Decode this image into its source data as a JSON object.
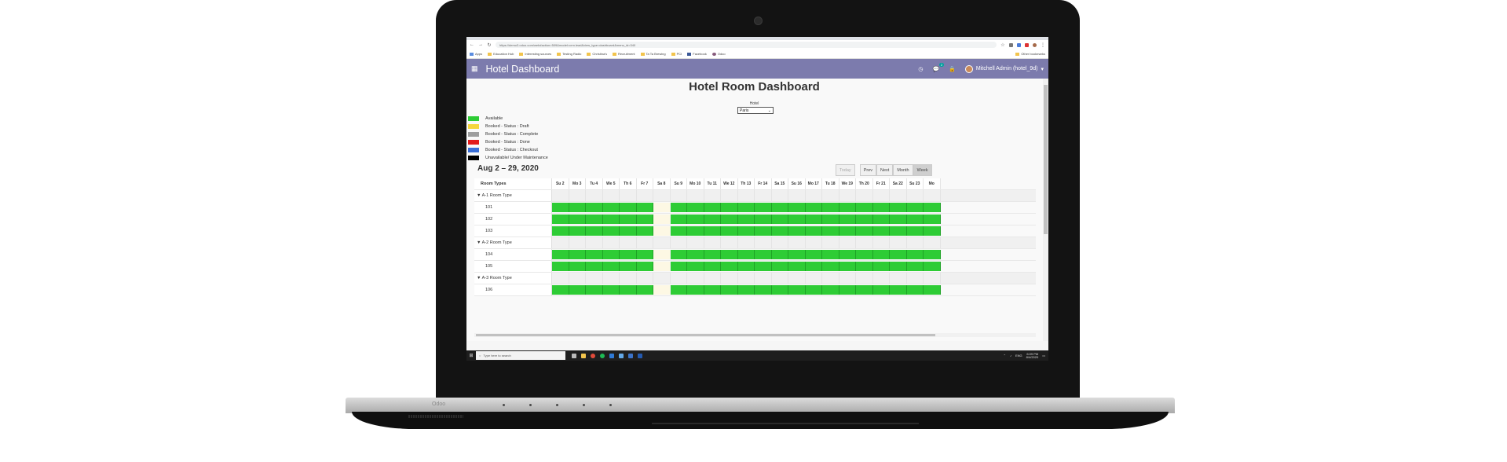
{
  "browser": {
    "url": "https://demo3.odoo.com/web#action=509&model=crm.lead&view_type=dashboard&menu_id=340",
    "bookmarks": [
      "Apps",
      "Education Hub",
      "Interesting sources",
      "Testing Radio",
      "Christina's",
      "Recruitment",
      "Ta Ta Brewing",
      "PCI",
      "Facebook",
      "Odoo"
    ],
    "other_bookmarks": "Other bookmarks"
  },
  "navbar": {
    "app_title": "Hotel Dashboard",
    "chat_count": "2",
    "user": "Mitchell Admin (hotel_9d)"
  },
  "page": {
    "title": "Hotel Room Dashboard",
    "hotel_label": "Hotel",
    "hotel_selected": "Paris"
  },
  "legend": [
    {
      "label": "Available",
      "color": "#2ecc35"
    },
    {
      "label": "Booked - Status : Draft",
      "color": "#f5d63d"
    },
    {
      "label": "Booked - Status : Complete",
      "color": "#9e9e9e"
    },
    {
      "label": "Booked - Status : Done",
      "color": "#e21b1b"
    },
    {
      "label": "Booked - Status : Checkout",
      "color": "#3a6fd8"
    },
    {
      "label": "Unavailable/ Under Maintenance",
      "color": "#000000"
    }
  ],
  "calendar": {
    "range": "Aug 2 – 29, 2020",
    "today": "Today",
    "prev": "Prev",
    "next": "Next",
    "month": "Month",
    "week": "Week",
    "column_header": "Room Types",
    "days": [
      "Su 2",
      "Mo 3",
      "Tu 4",
      "We 5",
      "Th 6",
      "Fr 7",
      "Sa 8",
      "Su 9",
      "Mo 10",
      "Tu 11",
      "We 12",
      "Th 13",
      "Fr 14",
      "Sa 15",
      "Su 16",
      "Mo 17",
      "Tu 18",
      "We 19",
      "Th 20",
      "Fr 21",
      "Sa 22",
      "Su 23",
      "Mo"
    ],
    "highlight_day_index": 6
  },
  "rows": [
    {
      "kind": "type",
      "label": "▼ A-1 Room Type"
    },
    {
      "kind": "room",
      "label": "101"
    },
    {
      "kind": "room",
      "label": "102"
    },
    {
      "kind": "room",
      "label": "103"
    },
    {
      "kind": "type",
      "label": "▼ A-2 Room Type"
    },
    {
      "kind": "room",
      "label": "104"
    },
    {
      "kind": "room",
      "label": "105"
    },
    {
      "kind": "type",
      "label": "▼ A-3 Room Type"
    },
    {
      "kind": "room",
      "label": "106"
    }
  ],
  "taskbar": {
    "search_placeholder": "Type here to search",
    "time": "6:09 PM",
    "date": "8/4/2020",
    "lang": "ENG"
  },
  "laptop_brand": "Odoo"
}
